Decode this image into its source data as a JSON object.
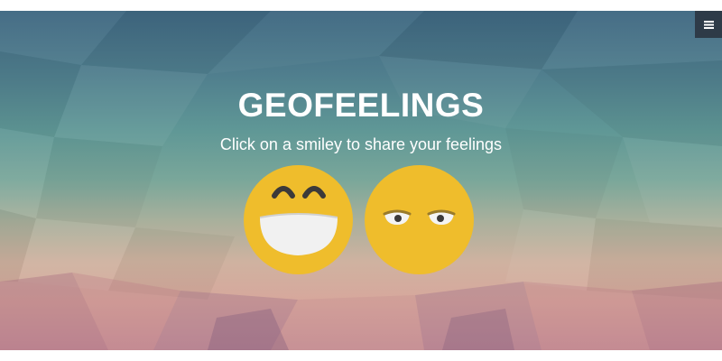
{
  "app": {
    "title": "GEOFEELINGS",
    "subtitle": "Click on a smiley to share your feelings"
  },
  "menu": {
    "icon": "hamburger-menu-icon"
  },
  "smileys": [
    {
      "name": "happy",
      "icon": "happy-smiley-icon",
      "color": "#f2c12e"
    },
    {
      "name": "sad",
      "icon": "sad-smiley-icon",
      "color": "#f2c12e"
    }
  ],
  "colors": {
    "menu_button": "#2e3b48",
    "text": "#ffffff",
    "smiley_yellow": "#f2c12e"
  }
}
